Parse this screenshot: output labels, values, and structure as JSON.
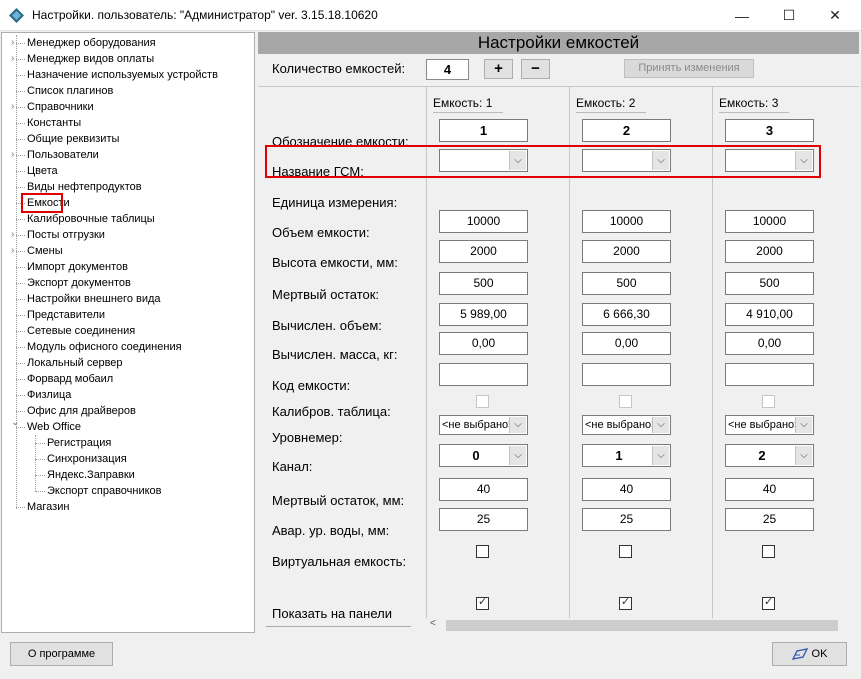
{
  "window": {
    "title": "Настройки. пользователь: \"Администратор\" ver. 3.15.18.10620",
    "minimize": "—",
    "maximize": "☐",
    "close": "✕"
  },
  "tree": {
    "items": [
      {
        "label": "Менеджер оборудования",
        "expandable": true
      },
      {
        "label": "Менеджер видов оплаты",
        "expandable": true
      },
      {
        "label": "Назначение используемых устройств",
        "expandable": false
      },
      {
        "label": "Список плагинов",
        "expandable": false
      },
      {
        "label": "Справочники",
        "expandable": true
      },
      {
        "label": "Константы",
        "expandable": false
      },
      {
        "label": "Общие реквизиты",
        "expandable": false
      },
      {
        "label": "Пользователи",
        "expandable": true
      },
      {
        "label": "Цвета",
        "expandable": false
      },
      {
        "label": "Виды нефтепродуктов",
        "expandable": false
      },
      {
        "label": "Емкости",
        "expandable": false,
        "selected": true
      },
      {
        "label": "Калибровочные таблицы",
        "expandable": false
      },
      {
        "label": "Посты отгрузки",
        "expandable": true
      },
      {
        "label": "Смены",
        "expandable": true
      },
      {
        "label": "Импорт документов",
        "expandable": false
      },
      {
        "label": "Экспорт документов",
        "expandable": false
      },
      {
        "label": "Настройки внешнего вида",
        "expandable": false
      },
      {
        "label": "Представители",
        "expandable": false
      },
      {
        "label": "Сетевые соединения",
        "expandable": false
      },
      {
        "label": "Модуль офисного соединения",
        "expandable": false
      },
      {
        "label": "Локальный сервер",
        "expandable": false
      },
      {
        "label": "Форвард мобаил",
        "expandable": false
      },
      {
        "label": "Физлица",
        "expandable": false
      },
      {
        "label": "Офис для драйверов",
        "expandable": false
      },
      {
        "label": "Web Office",
        "expandable": true,
        "expanded": true
      },
      {
        "label": "Регистрация",
        "child": true
      },
      {
        "label": "Синхронизация",
        "child": true
      },
      {
        "label": "Яндекс.Заправки",
        "child": true
      },
      {
        "label": "Экспорт справочников",
        "child": true
      },
      {
        "label": "Магазин",
        "expandable": false
      }
    ]
  },
  "panel": {
    "title": "Настройки емкостей",
    "count_label": "Количество емкостей:",
    "count_value": "4",
    "plus": "+",
    "minus": "−",
    "apply": "Принять изменения"
  },
  "rows": {
    "designation": "Обозначение емкости:",
    "fuel_name": "Название ГСМ:",
    "unit": "Единица измерения:",
    "volume": "Объем емкости:",
    "height": "Высота емкости, мм:",
    "dead_rest": "Мертвый остаток:",
    "calc_volume": "Вычислен. объем:",
    "calc_mass": "Вычислен. масса, кг:",
    "code": "Код емкости:",
    "calib_table": "Калибров. таблица:",
    "level_gauge": "Уровнемер:",
    "channel": "Канал:",
    "dead_rest_mm": "Мертвый остаток, мм:",
    "water_alarm": "Авар. ур. воды, мм:",
    "virtual": "Виртуальная емкость:",
    "show_panel": "Показать на панели"
  },
  "tanks": [
    {
      "header": "Емкость: 1",
      "designation": "1",
      "fuel": "",
      "volume": "10000",
      "height": "2000",
      "dead_rest": "500",
      "calc_volume": "5 989,00",
      "calc_mass": "0,00",
      "code": "",
      "calib": false,
      "gauge": "<не выбрано>",
      "channel": "0",
      "dead_rest_mm": "40",
      "water_alarm": "25",
      "virtual": false,
      "show": true
    },
    {
      "header": "Емкость: 2",
      "designation": "2",
      "fuel": "",
      "volume": "10000",
      "height": "2000",
      "dead_rest": "500",
      "calc_volume": "6 666,30",
      "calc_mass": "0,00",
      "code": "",
      "calib": false,
      "gauge": "<не выбрано>",
      "channel": "1",
      "dead_rest_mm": "40",
      "water_alarm": "25",
      "virtual": false,
      "show": true
    },
    {
      "header": "Емкость: 3",
      "designation": "3",
      "fuel": "",
      "volume": "10000",
      "height": "2000",
      "dead_rest": "500",
      "calc_volume": "4 910,00",
      "calc_mass": "0,00",
      "code": "",
      "calib": false,
      "gauge": "<не выбрано>",
      "channel": "2",
      "dead_rest_mm": "40",
      "water_alarm": "25",
      "virtual": false,
      "show": true
    }
  ],
  "footer": {
    "about": "О программе",
    "ok": "OK"
  },
  "colors": {
    "highlight": "#e10000",
    "panel_header": "#a7a7a7"
  }
}
